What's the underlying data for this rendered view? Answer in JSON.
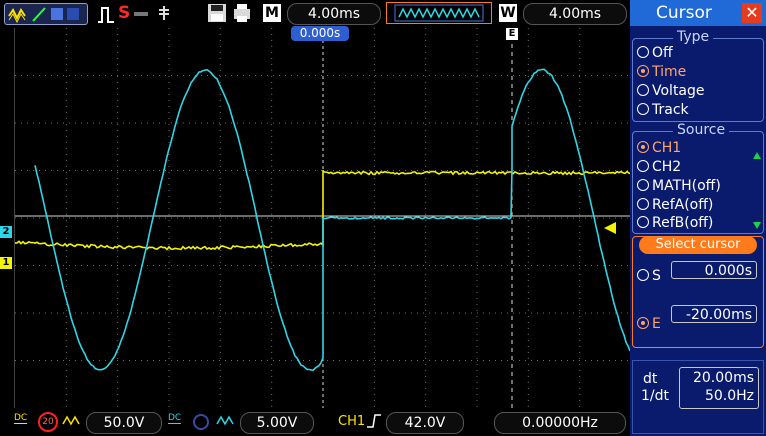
{
  "topbar": {
    "mode_badge": "M",
    "timebase": "4.00ms",
    "window_badge": "W",
    "window_timebase": "4.00ms",
    "stop_label": "S"
  },
  "scope": {
    "trigger_time": "0.000s",
    "cursor_e_marker": "E",
    "ch1_marker": "1",
    "ch2_marker": "2",
    "colors": {
      "ch1": "#f4f400",
      "ch2": "#2fd6e6",
      "grid": "#6a6a6a"
    }
  },
  "bottombar": {
    "ch1_coupling": "DC",
    "ch1_bw": "20",
    "ch1_scale": "50.0V",
    "ch2_coupling": "DC",
    "ch2_scale": "5.00V",
    "trigger_source": "CH1",
    "trigger_level": "42.0V",
    "frequency": "0.00000Hz"
  },
  "panel": {
    "title": "Cursor",
    "type_label": "Type",
    "type_options": [
      "Off",
      "Time",
      "Voltage",
      "Track"
    ],
    "type_selected": 1,
    "source_label": "Source",
    "source_options": [
      "CH1",
      "CH2",
      "MATH(off)",
      "RefA(off)",
      "RefB(off)"
    ],
    "source_selected": 0,
    "select_cursor_label": "Select cursor",
    "s_label": "S",
    "s_value": "0.000s",
    "e_label": "E",
    "e_value": "-20.00ms",
    "dt_label": "dt",
    "dt_value": "20.00ms",
    "inv_dt_label": "1/dt",
    "inv_dt_value": "50.0Hz"
  }
}
